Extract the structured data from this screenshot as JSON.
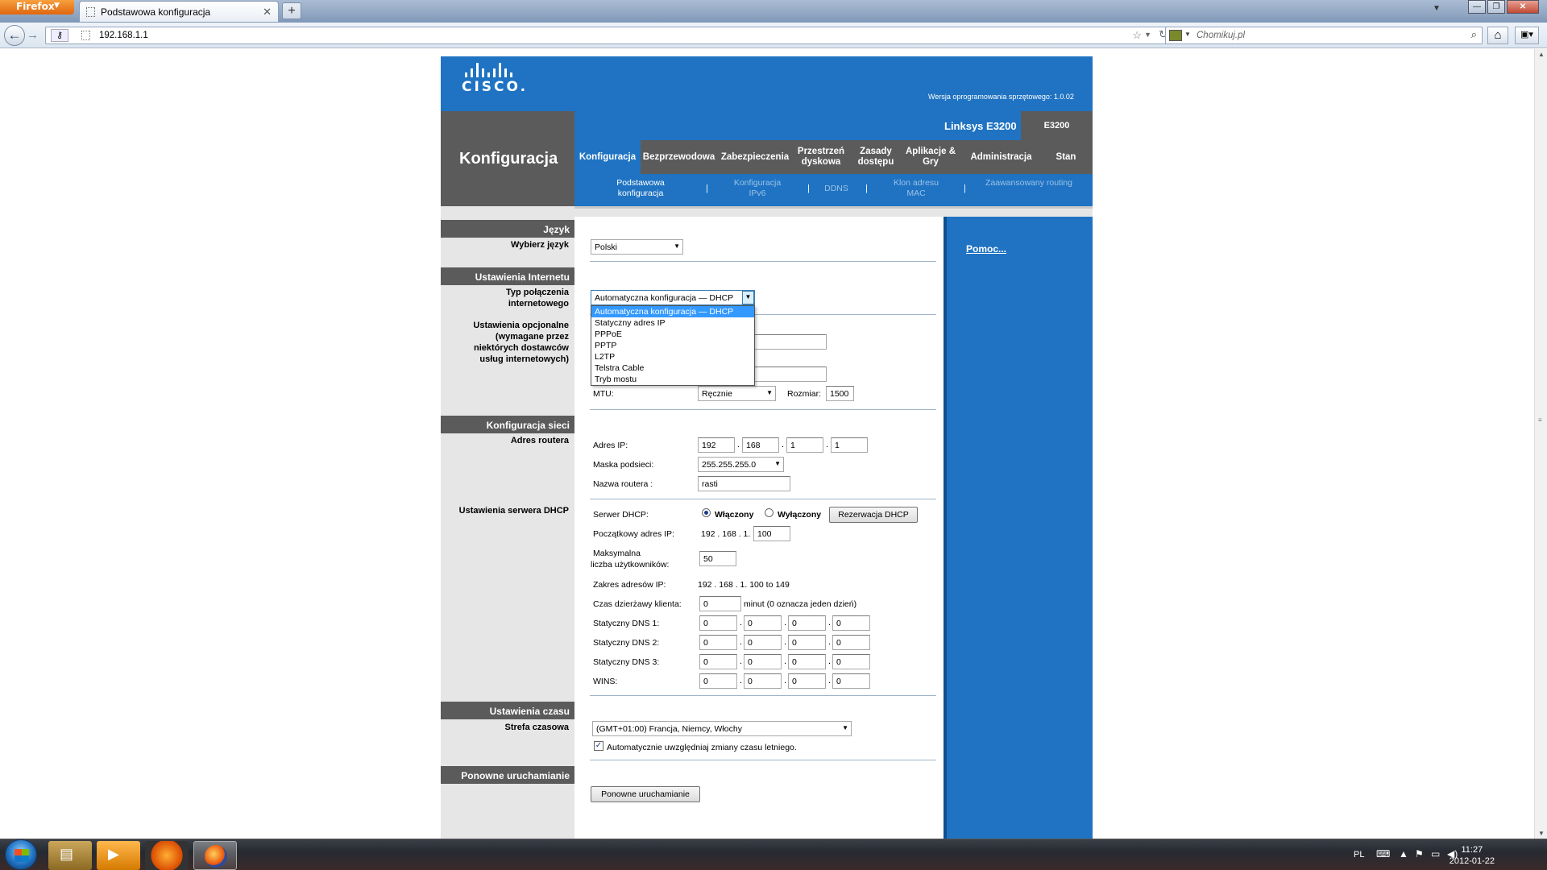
{
  "browser": {
    "menu_button": "Firefox",
    "tab_title": "Podstawowa konfiguracja",
    "new_tab": "+",
    "url": "192.168.1.1",
    "search_placeholder": "Chomikuj.pl"
  },
  "router": {
    "brand": "CISCO.",
    "firmware": "Wersja oprogramowania sprzętowego: 1.0.02",
    "section_title": "Konfiguracja",
    "model_name": "Linksys E3200",
    "model_code": "E3200",
    "menu": [
      "Konfiguracja",
      "Bezprzewodowa",
      "Zabezpieczenia",
      "Przestrzeń dyskowa",
      "Zasady dostępu",
      "Aplikacje & Gry",
      "Administracja",
      "Stan"
    ],
    "submenu": [
      "Podstawowa konfiguracja",
      "Konfiguracja IPv6",
      "DDNS",
      "Klon adresu MAC",
      "Zaawansowany routing"
    ],
    "help": "Pomoc..."
  },
  "language": {
    "header": "Język",
    "label": "Wybierz język",
    "value": "Polski"
  },
  "internet": {
    "header": "Ustawienia Internetu",
    "type_label": "Typ połączenia internetowego",
    "type_value": "Automatyczna konfiguracja — DHCP",
    "optional_label": "Ustawienia opcjonalne (wymagane przez niektórych dostawców usług internetowych)",
    "options": [
      "Automatyczna konfiguracja — DHCP",
      "Statyczny adres IP",
      "PPPoE",
      "PPTP",
      "L2TP",
      "Telstra Cable",
      "Tryb mostu"
    ],
    "mtu_label": "MTU:",
    "mtu_mode": "Ręcznie",
    "size_label": "Rozmiar:",
    "size_value": "1500"
  },
  "network": {
    "header": "Konfiguracja sieci",
    "router_addr_label": "Adres routera",
    "ip_label": "Adres IP:",
    "ip": [
      "192",
      "168",
      "1",
      "1"
    ],
    "mask_label": "Maska podsieci:",
    "mask": "255.255.255.0",
    "name_label": "Nazwa routera :",
    "name": "rasti"
  },
  "dhcp": {
    "section_label": "Ustawienia serwera DHCP",
    "server_label": "Serwer DHCP:",
    "on": "Włączony",
    "off": "Wyłączony",
    "reserve_btn": "Rezerwacja DHCP",
    "start_label": "Początkowy adres IP:",
    "start_prefix": "192 . 168 . 1.",
    "start_value": "100",
    "max_label_1": "Maksymalna",
    "max_label_2": "liczba użytkowników:",
    "max_value": "50",
    "range_label": "Zakres adresów IP:",
    "range_value": "192 . 168 . 1. 100 to 149",
    "lease_label": "Czas dzierżawy klienta:",
    "lease_value": "0",
    "lease_suffix": "minut (0 oznacza jeden dzień)",
    "dns1_label": "Statyczny DNS 1:",
    "dns2_label": "Statyczny DNS 2:",
    "dns3_label": "Statyczny DNS 3:",
    "wins_label": "WINS:",
    "octet": "0"
  },
  "time": {
    "header": "Ustawienia czasu",
    "tz_label": "Strefa czasowa",
    "tz_value": "(GMT+01:00) Francja, Niemcy, Włochy",
    "dst_label": "Automatycznie uwzględniaj zmiany czasu letniego."
  },
  "reboot": {
    "header": "Ponowne uruchamianie",
    "button": "Ponowne uruchamianie"
  },
  "taskbar": {
    "lang": "PL",
    "time": "11:27",
    "date": "2012-01-22"
  }
}
